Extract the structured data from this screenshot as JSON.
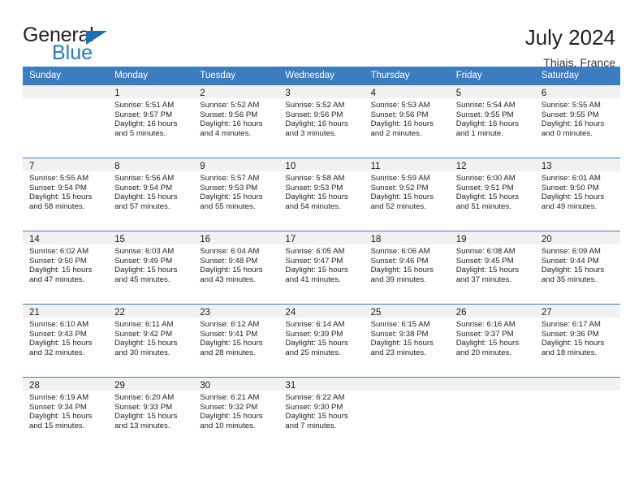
{
  "brand": {
    "name_top": "General",
    "name_bottom": "Blue",
    "color_black": "#231f20",
    "color_blue": "#1f7ac2"
  },
  "header": {
    "title": "July 2024",
    "subtitle": "Thiais, France"
  },
  "theme": {
    "header_bar": "#3b7dc0",
    "daynum_bg": "#f1f1f1",
    "text": "#232323"
  },
  "labels": {
    "sunrise_prefix": "Sunrise:",
    "sunset_prefix": "Sunset:",
    "daylight_prefix": "Daylight:"
  },
  "weekdays": [
    "Sunday",
    "Monday",
    "Tuesday",
    "Wednesday",
    "Thursday",
    "Friday",
    "Saturday"
  ],
  "weeks": [
    [
      {
        "day": "",
        "sunrise": "",
        "sunset": "",
        "daylight1": "",
        "daylight2": ""
      },
      {
        "day": "1",
        "sunrise": "Sunrise: 5:51 AM",
        "sunset": "Sunset: 9:57 PM",
        "daylight1": "Daylight: 16 hours",
        "daylight2": "and 5 minutes."
      },
      {
        "day": "2",
        "sunrise": "Sunrise: 5:52 AM",
        "sunset": "Sunset: 9:56 PM",
        "daylight1": "Daylight: 16 hours",
        "daylight2": "and 4 minutes."
      },
      {
        "day": "3",
        "sunrise": "Sunrise: 5:52 AM",
        "sunset": "Sunset: 9:56 PM",
        "daylight1": "Daylight: 16 hours",
        "daylight2": "and 3 minutes."
      },
      {
        "day": "4",
        "sunrise": "Sunrise: 5:53 AM",
        "sunset": "Sunset: 9:56 PM",
        "daylight1": "Daylight: 16 hours",
        "daylight2": "and 2 minutes."
      },
      {
        "day": "5",
        "sunrise": "Sunrise: 5:54 AM",
        "sunset": "Sunset: 9:55 PM",
        "daylight1": "Daylight: 16 hours",
        "daylight2": "and 1 minute."
      },
      {
        "day": "6",
        "sunrise": "Sunrise: 5:55 AM",
        "sunset": "Sunset: 9:55 PM",
        "daylight1": "Daylight: 16 hours",
        "daylight2": "and 0 minutes."
      }
    ],
    [
      {
        "day": "7",
        "sunrise": "Sunrise: 5:55 AM",
        "sunset": "Sunset: 9:54 PM",
        "daylight1": "Daylight: 15 hours",
        "daylight2": "and 58 minutes."
      },
      {
        "day": "8",
        "sunrise": "Sunrise: 5:56 AM",
        "sunset": "Sunset: 9:54 PM",
        "daylight1": "Daylight: 15 hours",
        "daylight2": "and 57 minutes."
      },
      {
        "day": "9",
        "sunrise": "Sunrise: 5:57 AM",
        "sunset": "Sunset: 9:53 PM",
        "daylight1": "Daylight: 15 hours",
        "daylight2": "and 55 minutes."
      },
      {
        "day": "10",
        "sunrise": "Sunrise: 5:58 AM",
        "sunset": "Sunset: 9:53 PM",
        "daylight1": "Daylight: 15 hours",
        "daylight2": "and 54 minutes."
      },
      {
        "day": "11",
        "sunrise": "Sunrise: 5:59 AM",
        "sunset": "Sunset: 9:52 PM",
        "daylight1": "Daylight: 15 hours",
        "daylight2": "and 52 minutes."
      },
      {
        "day": "12",
        "sunrise": "Sunrise: 6:00 AM",
        "sunset": "Sunset: 9:51 PM",
        "daylight1": "Daylight: 15 hours",
        "daylight2": "and 51 minutes."
      },
      {
        "day": "13",
        "sunrise": "Sunrise: 6:01 AM",
        "sunset": "Sunset: 9:50 PM",
        "daylight1": "Daylight: 15 hours",
        "daylight2": "and 49 minutes."
      }
    ],
    [
      {
        "day": "14",
        "sunrise": "Sunrise: 6:02 AM",
        "sunset": "Sunset: 9:50 PM",
        "daylight1": "Daylight: 15 hours",
        "daylight2": "and 47 minutes."
      },
      {
        "day": "15",
        "sunrise": "Sunrise: 6:03 AM",
        "sunset": "Sunset: 9:49 PM",
        "daylight1": "Daylight: 15 hours",
        "daylight2": "and 45 minutes."
      },
      {
        "day": "16",
        "sunrise": "Sunrise: 6:04 AM",
        "sunset": "Sunset: 9:48 PM",
        "daylight1": "Daylight: 15 hours",
        "daylight2": "and 43 minutes."
      },
      {
        "day": "17",
        "sunrise": "Sunrise: 6:05 AM",
        "sunset": "Sunset: 9:47 PM",
        "daylight1": "Daylight: 15 hours",
        "daylight2": "and 41 minutes."
      },
      {
        "day": "18",
        "sunrise": "Sunrise: 6:06 AM",
        "sunset": "Sunset: 9:46 PM",
        "daylight1": "Daylight: 15 hours",
        "daylight2": "and 39 minutes."
      },
      {
        "day": "19",
        "sunrise": "Sunrise: 6:08 AM",
        "sunset": "Sunset: 9:45 PM",
        "daylight1": "Daylight: 15 hours",
        "daylight2": "and 37 minutes."
      },
      {
        "day": "20",
        "sunrise": "Sunrise: 6:09 AM",
        "sunset": "Sunset: 9:44 PM",
        "daylight1": "Daylight: 15 hours",
        "daylight2": "and 35 minutes."
      }
    ],
    [
      {
        "day": "21",
        "sunrise": "Sunrise: 6:10 AM",
        "sunset": "Sunset: 9:43 PM",
        "daylight1": "Daylight: 15 hours",
        "daylight2": "and 32 minutes."
      },
      {
        "day": "22",
        "sunrise": "Sunrise: 6:11 AM",
        "sunset": "Sunset: 9:42 PM",
        "daylight1": "Daylight: 15 hours",
        "daylight2": "and 30 minutes."
      },
      {
        "day": "23",
        "sunrise": "Sunrise: 6:12 AM",
        "sunset": "Sunset: 9:41 PM",
        "daylight1": "Daylight: 15 hours",
        "daylight2": "and 28 minutes."
      },
      {
        "day": "24",
        "sunrise": "Sunrise: 6:14 AM",
        "sunset": "Sunset: 9:39 PM",
        "daylight1": "Daylight: 15 hours",
        "daylight2": "and 25 minutes."
      },
      {
        "day": "25",
        "sunrise": "Sunrise: 6:15 AM",
        "sunset": "Sunset: 9:38 PM",
        "daylight1": "Daylight: 15 hours",
        "daylight2": "and 23 minutes."
      },
      {
        "day": "26",
        "sunrise": "Sunrise: 6:16 AM",
        "sunset": "Sunset: 9:37 PM",
        "daylight1": "Daylight: 15 hours",
        "daylight2": "and 20 minutes."
      },
      {
        "day": "27",
        "sunrise": "Sunrise: 6:17 AM",
        "sunset": "Sunset: 9:36 PM",
        "daylight1": "Daylight: 15 hours",
        "daylight2": "and 18 minutes."
      }
    ],
    [
      {
        "day": "28",
        "sunrise": "Sunrise: 6:19 AM",
        "sunset": "Sunset: 9:34 PM",
        "daylight1": "Daylight: 15 hours",
        "daylight2": "and 15 minutes."
      },
      {
        "day": "29",
        "sunrise": "Sunrise: 6:20 AM",
        "sunset": "Sunset: 9:33 PM",
        "daylight1": "Daylight: 15 hours",
        "daylight2": "and 13 minutes."
      },
      {
        "day": "30",
        "sunrise": "Sunrise: 6:21 AM",
        "sunset": "Sunset: 9:32 PM",
        "daylight1": "Daylight: 15 hours",
        "daylight2": "and 10 minutes."
      },
      {
        "day": "31",
        "sunrise": "Sunrise: 6:22 AM",
        "sunset": "Sunset: 9:30 PM",
        "daylight1": "Daylight: 15 hours",
        "daylight2": "and 7 minutes."
      },
      {
        "day": "",
        "sunrise": "",
        "sunset": "",
        "daylight1": "",
        "daylight2": ""
      },
      {
        "day": "",
        "sunrise": "",
        "sunset": "",
        "daylight1": "",
        "daylight2": ""
      },
      {
        "day": "",
        "sunrise": "",
        "sunset": "",
        "daylight1": "",
        "daylight2": ""
      }
    ]
  ]
}
